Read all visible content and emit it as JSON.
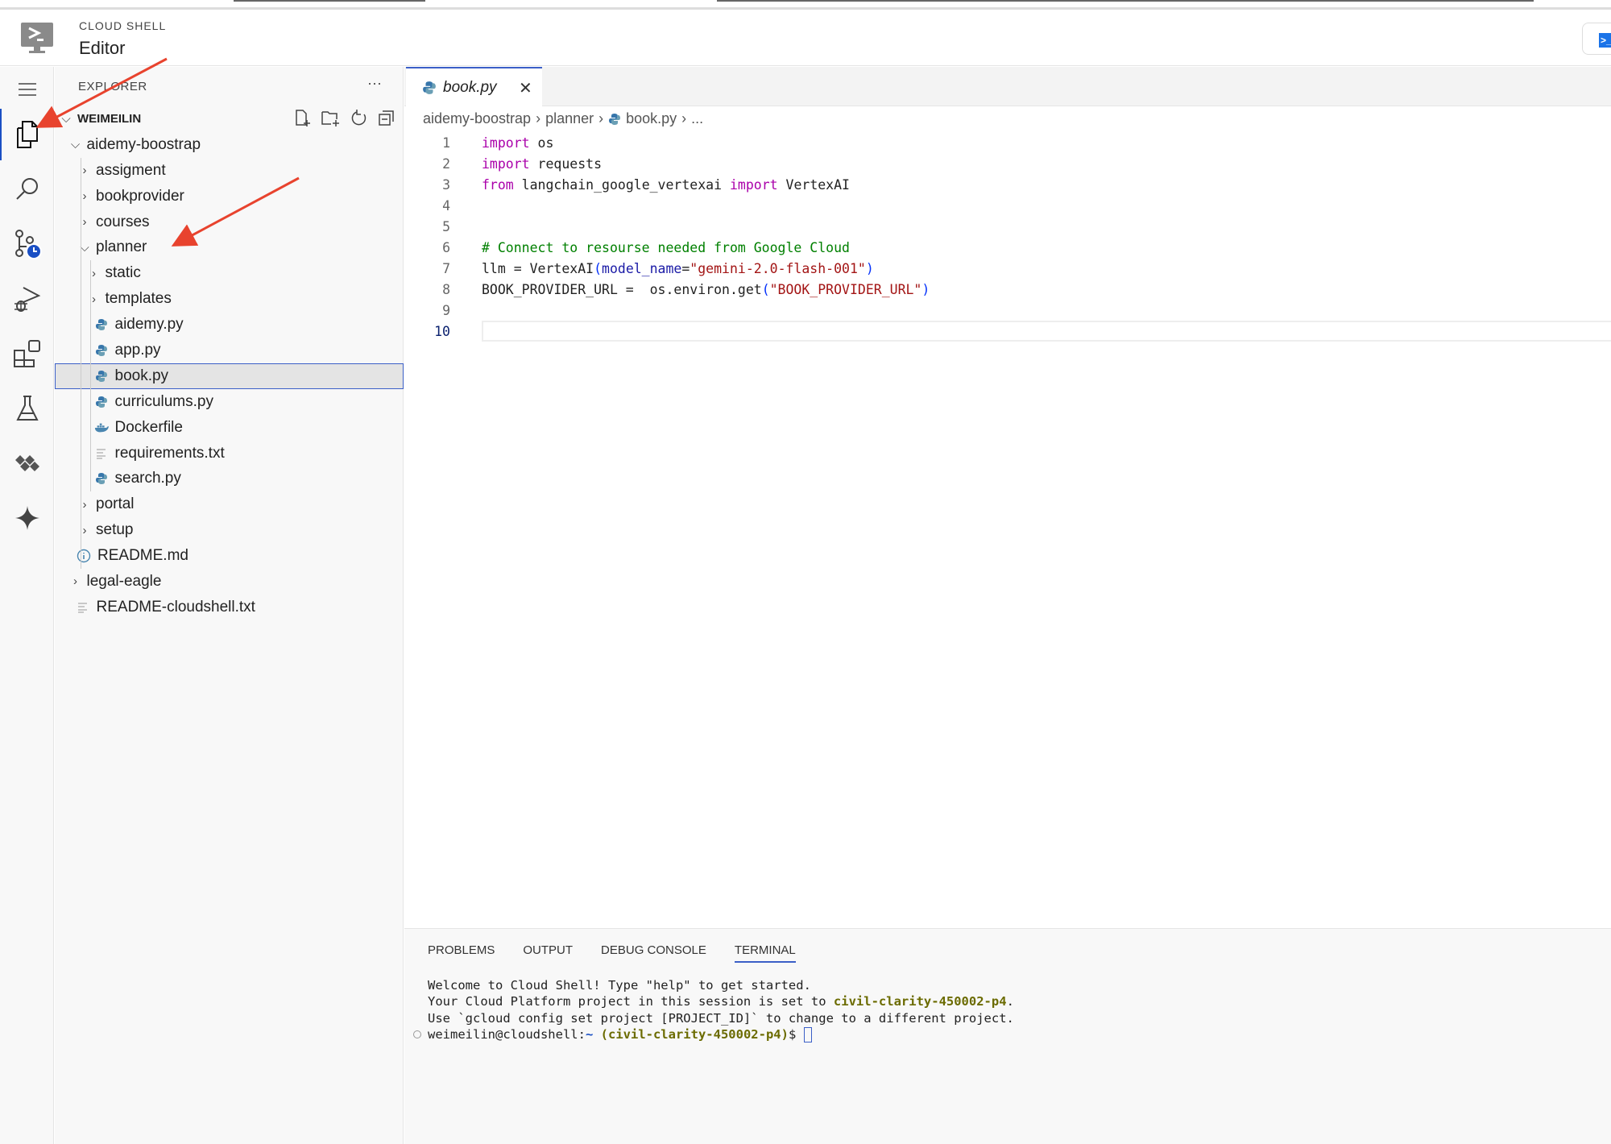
{
  "header": {
    "subtitle": "CLOUD SHELL",
    "title": "Editor"
  },
  "activity_bar": {
    "items": [
      "menu-icon",
      "explorer-icon",
      "search-icon",
      "source-control-icon",
      "run-debug-icon",
      "extensions-icon",
      "testing-icon",
      "cloud-code-icon",
      "gemini-icon"
    ]
  },
  "explorer": {
    "title": "EXPLORER",
    "more": "···",
    "root": "WEIMEILIN",
    "rows": [
      {
        "label": "aidemy-boostrap",
        "depth": 1,
        "type": "folder-open"
      },
      {
        "label": "assigment",
        "depth": 2,
        "type": "folder"
      },
      {
        "label": "bookprovider",
        "depth": 2,
        "type": "folder"
      },
      {
        "label": "courses",
        "depth": 2,
        "type": "folder"
      },
      {
        "label": "planner",
        "depth": 2,
        "type": "folder-open"
      },
      {
        "label": "static",
        "depth": 3,
        "type": "folder"
      },
      {
        "label": "templates",
        "depth": 3,
        "type": "folder"
      },
      {
        "label": "aidemy.py",
        "depth": 3,
        "type": "python"
      },
      {
        "label": "app.py",
        "depth": 3,
        "type": "python"
      },
      {
        "label": "book.py",
        "depth": 3,
        "type": "python",
        "selected": true
      },
      {
        "label": "curriculums.py",
        "depth": 3,
        "type": "python"
      },
      {
        "label": "Dockerfile",
        "depth": 3,
        "type": "docker"
      },
      {
        "label": "requirements.txt",
        "depth": 3,
        "type": "text"
      },
      {
        "label": "search.py",
        "depth": 3,
        "type": "python"
      },
      {
        "label": "portal",
        "depth": 2,
        "type": "folder"
      },
      {
        "label": "setup",
        "depth": 2,
        "type": "folder"
      },
      {
        "label": "README.md",
        "depth": 2,
        "type": "info"
      },
      {
        "label": "legal-eagle",
        "depth": 1,
        "type": "folder"
      },
      {
        "label": "README-cloudshell.txt",
        "depth": 1,
        "type": "text"
      }
    ]
  },
  "editor": {
    "tab": {
      "label": "book.py",
      "close": "✕"
    },
    "breadcrumb": [
      "aidemy-boostrap",
      "planner",
      "book.py",
      "..."
    ],
    "current_line": 10,
    "lines": [
      [
        {
          "t": "import",
          "c": "kw"
        },
        {
          "t": " os"
        }
      ],
      [
        {
          "t": "import",
          "c": "kw"
        },
        {
          "t": " requests"
        }
      ],
      [
        {
          "t": "from",
          "c": "kw"
        },
        {
          "t": " langchain_google_vertexai "
        },
        {
          "t": "import",
          "c": "kw"
        },
        {
          "t": " VertexAI"
        }
      ],
      [],
      [],
      [
        {
          "t": "# Connect to resourse needed from Google Cloud",
          "c": "cm"
        }
      ],
      [
        {
          "t": "llm = VertexAI"
        },
        {
          "t": "(",
          "c": "par"
        },
        {
          "t": "model_name",
          "c": "pr"
        },
        {
          "t": "="
        },
        {
          "t": "\"gemini-2.0-flash-001\"",
          "c": "st"
        },
        {
          "t": ")",
          "c": "par"
        }
      ],
      [
        {
          "t": "BOOK_PROVIDER_URL =  os.environ.get"
        },
        {
          "t": "(",
          "c": "par"
        },
        {
          "t": "\"BOOK_PROVIDER_URL\"",
          "c": "st"
        },
        {
          "t": ")",
          "c": "par"
        }
      ],
      [],
      []
    ]
  },
  "panel": {
    "tabs": [
      "PROBLEMS",
      "OUTPUT",
      "DEBUG CONSOLE",
      "TERMINAL"
    ],
    "active_tab": "TERMINAL",
    "terminal": {
      "line1": "Welcome to Cloud Shell! Type \"help\" to get started.",
      "line2_prefix": "Your Cloud Platform project in this session is set to ",
      "project": "civil-clarity-450002-p4",
      "line2_suffix": ".",
      "line3": "Use `gcloud config set project [PROJECT_ID]` to change to a different project.",
      "prompt_user": "weimeilin@cloudshell:",
      "prompt_path": "~",
      "prompt_project": "(civil-clarity-450002-p4)",
      "prompt_symbol": "$ "
    }
  },
  "colors": {
    "accent": "#3b5fc7",
    "annotation_arrow": "#e8432e",
    "keyword": "#aa00aa",
    "comment": "#008000",
    "string": "#a31515"
  }
}
